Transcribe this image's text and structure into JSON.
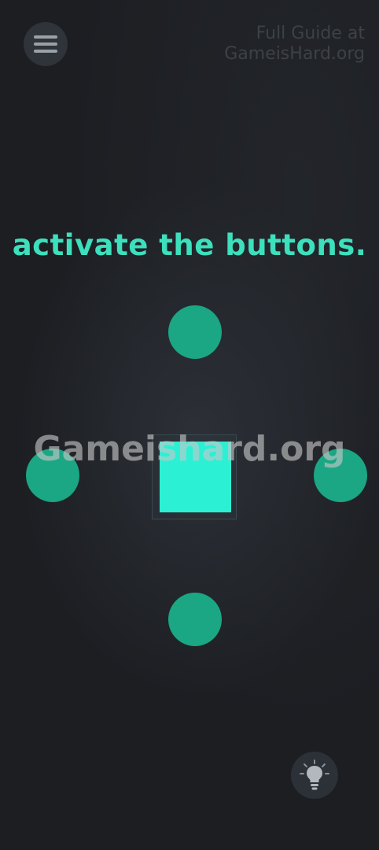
{
  "header": {
    "menu_icon": "hamburger-menu-icon",
    "guide_line1": "Full Guide at",
    "guide_line2": "GameisHard.org"
  },
  "puzzle": {
    "instruction": "activate the buttons.",
    "button_color": "#1ba684",
    "square_color": "#2cf0d4",
    "text_color": "#3ce0bd"
  },
  "watermark": "Gameishard.org",
  "footer": {
    "hint_icon": "lightbulb-icon"
  }
}
